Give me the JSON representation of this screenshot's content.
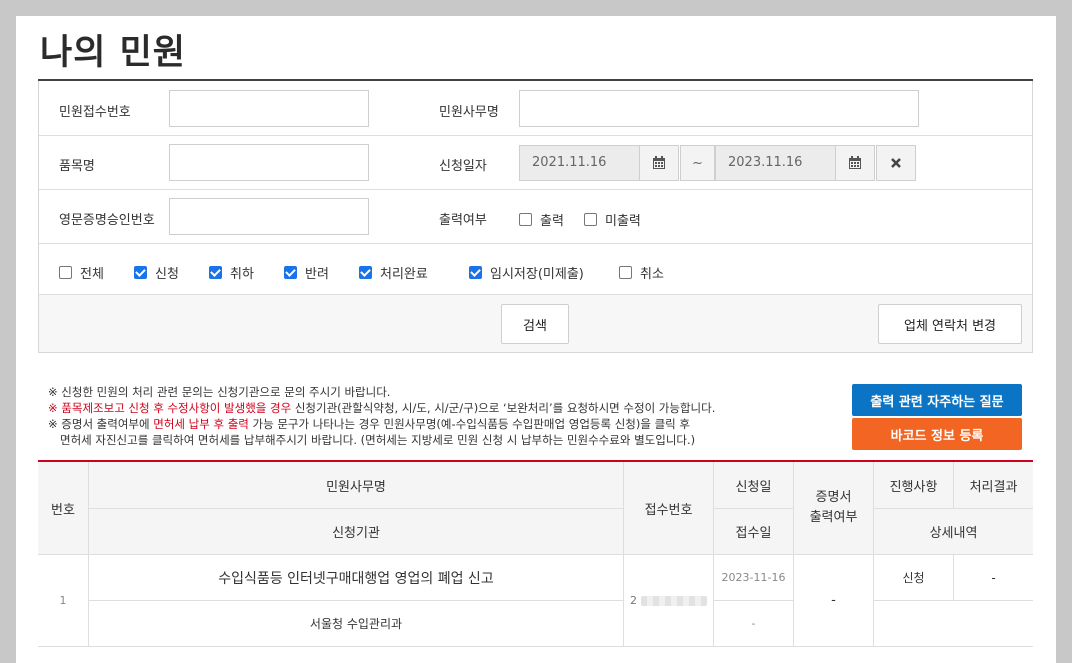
{
  "page_title": "나의 민원",
  "search": {
    "receipt_no_label": "민원접수번호",
    "receipt_no_value": "",
    "affair_name_label": "민원사무명",
    "affair_name_value": "",
    "product_label": "품목명",
    "product_value": "",
    "apply_date_label": "신청일자",
    "date_from": "2021.11.16",
    "date_to": "2023.11.16",
    "tilde": "~",
    "cert_approval_label": "영문증명승인번호",
    "cert_approval_value": "",
    "print_label": "출력여부",
    "print_options": [
      {
        "label": "출력",
        "checked": false
      },
      {
        "label": "미출력",
        "checked": false
      }
    ],
    "status_options": [
      {
        "label": "전체",
        "checked": false
      },
      {
        "label": "신청",
        "checked": true
      },
      {
        "label": "취하",
        "checked": true
      },
      {
        "label": "반려",
        "checked": true
      },
      {
        "label": "처리완료",
        "checked": true
      },
      {
        "label": "임시저장(미제출)",
        "checked": true
      },
      {
        "label": "취소",
        "checked": false
      }
    ],
    "search_button": "검색",
    "contact_button": "업체 연락처 변경"
  },
  "notes": {
    "line1": "※ 신청한 민원의 처리 관련 문의는 신청기관으로 문의 주시기 바랍니다.",
    "line2_prefix": "※ ",
    "line2_red": "품목제조보고 신청 후 수정사항이 발생했을 경우",
    "line2_rest": " 신청기관(관할식약청, 시/도, 시/군/구)으로 ‘보완처리’를 요청하시면 수정이 가능합니다.",
    "line3_prefix": "※ 증명서 출력여부에 ",
    "line3_red": "면허세 납부 후 출력",
    "line3_rest": " 가능 문구가 나타나는 경우 민원사무명(예-수입식품등 수입판매업 영업등록 신청)을 클릭 후",
    "line4": "면허세 자진신고를 클릭하여 면허세를 납부해주시기 바랍니다. (면허세는 지방세로 민원 신청 시 납부하는 민원수수료와 별도입니다.)"
  },
  "side_buttons": {
    "faq": "출력 관련 자주하는 질문",
    "barcode": "바코드 정보 등록"
  },
  "colors": {
    "faq_button": "#0b74c4",
    "barcode_button": "#f26522",
    "accent_red": "#d0021b",
    "checkbox_blue": "#1a73e8"
  },
  "table": {
    "headers": {
      "no": "번호",
      "affair_name": "민원사무명",
      "agency": "신청기관",
      "receipt_no": "접수번호",
      "apply_date": "신청일",
      "receipt_date": "접수일",
      "cert_print": "증명서\n출력여부",
      "progress": "진행사항",
      "result": "처리결과",
      "detail": "상세내역"
    },
    "rows": [
      {
        "no": "1",
        "affair_name": "수입식품등 인터넷구매대행업 영업의 폐업 신고",
        "agency": "서울청 수입관리과",
        "receipt_no": "2",
        "apply_date": "2023-11-16",
        "receipt_date": "-",
        "cert_print": "-",
        "progress": "신청",
        "result": "-"
      }
    ]
  }
}
